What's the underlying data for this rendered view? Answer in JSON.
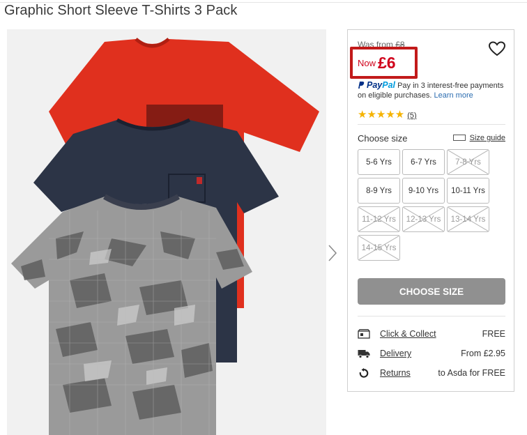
{
  "product": {
    "title": "Graphic Short Sleeve T-Shirts 3 Pack"
  },
  "price": {
    "was_label": "Was from",
    "was_value": "£8",
    "now_label": "Now",
    "now_value": "£6"
  },
  "paypal": {
    "logo_pay": "Pay",
    "logo_pal": "Pal",
    "text": "Pay in 3 interest-free payments on eligible purchases.",
    "link": "Learn more"
  },
  "rating": {
    "stars": "★★★★★",
    "count": "(5)"
  },
  "size": {
    "label": "Choose size",
    "guide": "Size guide",
    "options": [
      {
        "label": "5-6 Yrs",
        "available": true
      },
      {
        "label": "6-7 Yrs",
        "available": true
      },
      {
        "label": "7-8 Yrs",
        "available": false
      },
      {
        "label": "8-9 Yrs",
        "available": true
      },
      {
        "label": "9-10 Yrs",
        "available": true
      },
      {
        "label": "10-11 Yrs",
        "available": true
      },
      {
        "label": "11-12 Yrs",
        "available": false
      },
      {
        "label": "12-13 Yrs",
        "available": false
      },
      {
        "label": "13-14 Yrs",
        "available": false
      },
      {
        "label": "14-15 Yrs",
        "available": false
      }
    ]
  },
  "cta": {
    "label": "CHOOSE SIZE"
  },
  "delivery": {
    "options": [
      {
        "label": "Click & Collect",
        "value": "FREE",
        "icon": "store-icon"
      },
      {
        "label": "Delivery",
        "value": "From £2.95",
        "icon": "truck-icon"
      },
      {
        "label": "Returns",
        "value": "to Asda for FREE",
        "icon": "return-icon"
      }
    ]
  },
  "colors": {
    "accent_red": "#d0021b",
    "highlight_border": "#c21a1a",
    "button_grey": "#909090",
    "star": "#f5b301"
  }
}
